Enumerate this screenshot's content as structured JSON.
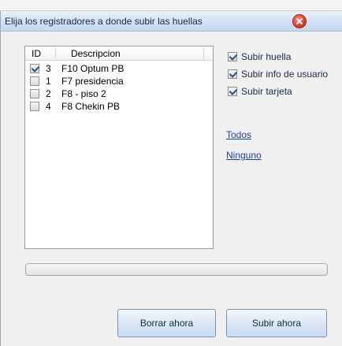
{
  "dialog": {
    "title": "Elija los registradores a donde subir las huellas",
    "close_icon": "close-icon"
  },
  "list": {
    "columns": {
      "id": "ID",
      "descripcion": "Descripcion"
    },
    "rows": [
      {
        "checked": true,
        "id": "3",
        "descripcion": "F10 Optum PB"
      },
      {
        "checked": false,
        "id": "1",
        "descripcion": "F7 presidencia"
      },
      {
        "checked": false,
        "id": "2",
        "descripcion": "F8 - piso 2"
      },
      {
        "checked": false,
        "id": "4",
        "descripcion": "F8 Chekin PB"
      }
    ]
  },
  "options": [
    {
      "label": "Subir huella",
      "checked": true
    },
    {
      "label": "Subir info de usuario",
      "checked": true
    },
    {
      "label": "Subir tarjeta",
      "checked": true
    }
  ],
  "links": {
    "todos": "Todos",
    "ninguno": "Ninguno"
  },
  "progress": {
    "value": 0
  },
  "buttons": {
    "borrar": "Borrar ahora",
    "subir": "Subir ahora"
  },
  "colors": {
    "link": "#1a3fb8",
    "titlebar": "#d3e1f2",
    "close": "#e2412d"
  }
}
